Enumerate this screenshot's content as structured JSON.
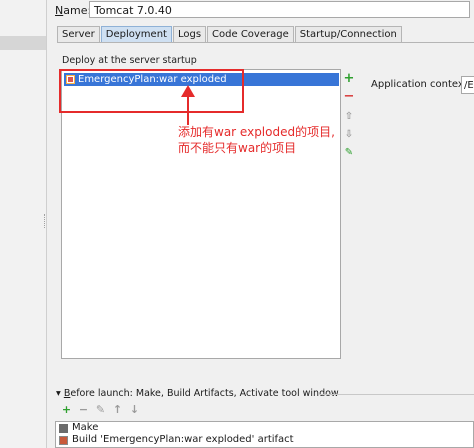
{
  "name_field": {
    "label_underlined": "N",
    "label_rest": "ame:",
    "value": "Tomcat 7.0.40"
  },
  "tabs": [
    {
      "label": "Server",
      "active": false
    },
    {
      "label": "Deployment",
      "active": true
    },
    {
      "label": "Logs",
      "active": false
    },
    {
      "label": "Code Coverage",
      "active": false
    },
    {
      "label": "Startup/Connection",
      "active": false
    }
  ],
  "deploy": {
    "label": "Deploy at the server startup",
    "items": [
      "EmergencyPlan:war exploded"
    ]
  },
  "toolbar": {
    "add": "+",
    "remove": "−",
    "up": "⇧",
    "down": "⇩",
    "edit": "✎"
  },
  "application_context": {
    "label": "Application context:",
    "value": "/E"
  },
  "annotation": {
    "line1": "添加有war exploded的项目,",
    "line2": "而不能只有war的项目"
  },
  "before_launch": {
    "arrow": "▾",
    "label_underlined": "B",
    "label_rest": "efore launch: Make, Build Artifacts, Activate tool window",
    "tools": {
      "add": "+",
      "remove": "−",
      "edit": "✎",
      "up": "↑",
      "down": "↓"
    },
    "items": [
      "Make",
      "Build 'EmergencyPlan:war exploded' artifact"
    ]
  },
  "colors": {
    "selection": "#3875d7",
    "annotation": "#e52b2b",
    "active_tab": "#cfe0f2"
  }
}
